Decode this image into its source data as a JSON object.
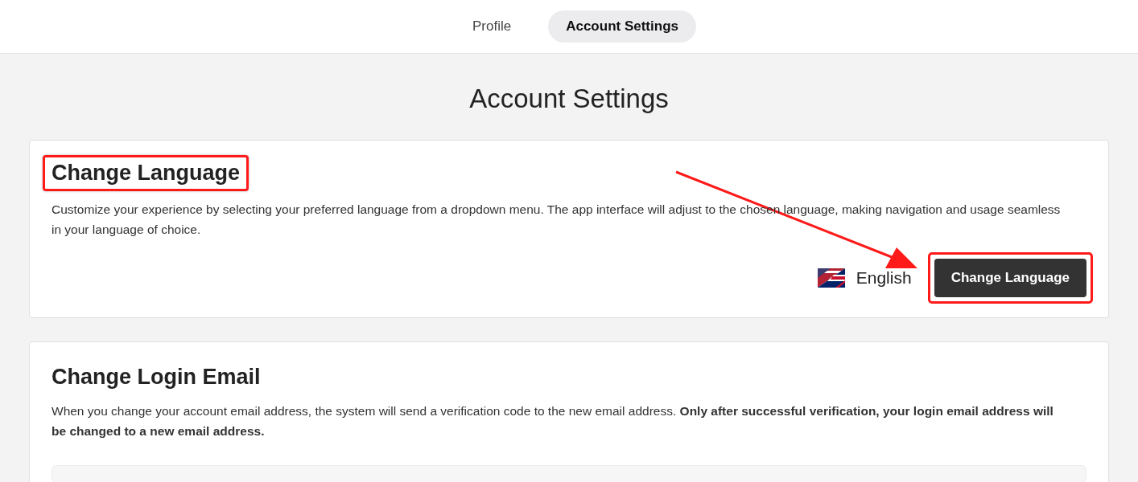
{
  "tabs": [
    {
      "label": "Profile",
      "selected": false
    },
    {
      "label": "Account Settings",
      "selected": true
    }
  ],
  "page_title": "Account Settings",
  "annotation_arrow": true,
  "sections": [
    {
      "kind": "language",
      "title": "Change Language",
      "title_highlighted": true,
      "description": "Customize your experience by selecting your preferred language from a dropdown menu. The app interface will adjust to the chosen language, making navigation and usage seamless in your language of choice.",
      "current_language": "English",
      "button": {
        "label": "Change Language",
        "highlighted": true
      }
    },
    {
      "kind": "email",
      "title": "Change Login Email",
      "title_highlighted": false,
      "description": "When you change your account email address, the system will send a verification code to the new email address. **Only after successful verification, your login email address will be changed to a new email address.**"
    }
  ]
}
